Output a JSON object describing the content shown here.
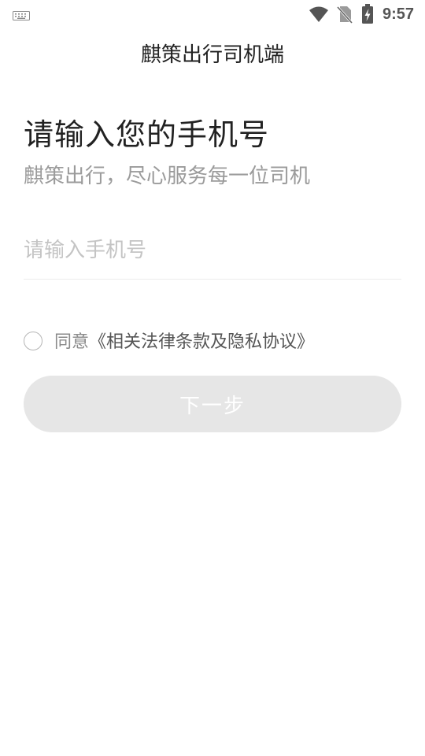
{
  "status_bar": {
    "time": "9:57",
    "icons": [
      "keyboard-icon",
      "wifi-icon",
      "no-sim-icon",
      "battery-charging-icon"
    ]
  },
  "header": {
    "title": "麒策出行司机端"
  },
  "main": {
    "headline": "请输入您的手机号",
    "subheadline": "麒策出行，尽心服务每一位司机",
    "phone_input": {
      "placeholder": "请输入手机号",
      "value": ""
    },
    "agreement": {
      "checked": false,
      "prefix": "同意",
      "link": "《相关法律条款及隐私协议》"
    },
    "next_button": {
      "label": "下一步",
      "enabled": false
    }
  },
  "colors": {
    "primary_text": "#222222",
    "secondary_text": "#9b9b9b",
    "placeholder": "#c4c4c4",
    "button_disabled_bg": "#e6e6e6",
    "button_text": "#ffffff"
  }
}
